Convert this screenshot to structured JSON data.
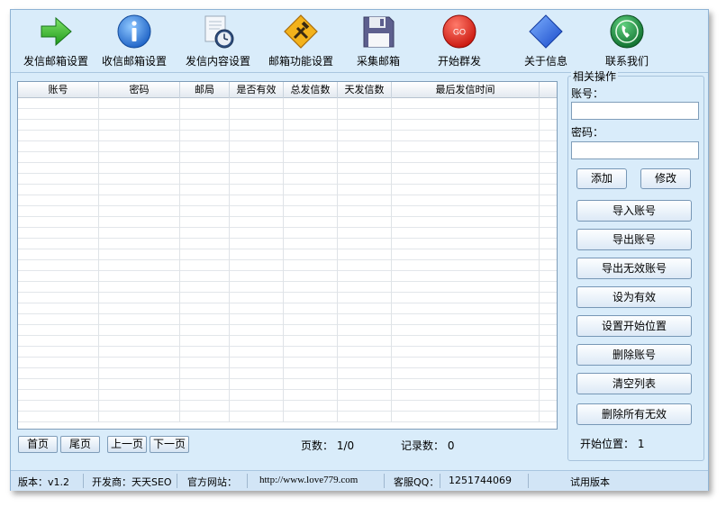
{
  "toolbar": {
    "items": [
      {
        "label": "发信邮箱设置",
        "icon": "green-arrow-icon"
      },
      {
        "label": "收信邮箱设置",
        "icon": "info-icon"
      },
      {
        "label": "发信内容设置",
        "icon": "document-clock-icon"
      },
      {
        "label": "邮箱功能设置",
        "icon": "tools-sign-icon"
      },
      {
        "label": "采集邮箱",
        "icon": "floppy-disk-icon"
      },
      {
        "label": "开始群发",
        "icon": "go-button-icon"
      },
      {
        "label": "关于信息",
        "icon": "blue-diamond-icon"
      },
      {
        "label": "联系我们",
        "icon": "phone-icon"
      }
    ]
  },
  "grid": {
    "columns": [
      "账号",
      "密码",
      "邮局",
      "是否有效",
      "总发信数",
      "天发信数",
      "最后发信时间",
      ""
    ],
    "rows": []
  },
  "pager": {
    "first": "首页",
    "last": "尾页",
    "prev": "上一页",
    "next": "下一页",
    "pages_text": "页数： 1/0",
    "records_text": "记录数： 0"
  },
  "panel": {
    "title": "相关操作",
    "account_label": "账号：",
    "account_value": "",
    "password_label": "密码：",
    "password_value": "",
    "add": "添加",
    "edit": "修改",
    "import": "导入账号",
    "export": "导出账号",
    "export_invalid": "导出无效账号",
    "set_valid": "设为有效",
    "set_start": "设置开始位置",
    "delete": "删除账号",
    "clear": "清空列表",
    "delete_invalid": "删除所有无效",
    "start_pos": "开始位置： 1"
  },
  "status": {
    "version": "版本：v1.2",
    "developer": "开发商：天天SEO",
    "site_label": "官方网站：",
    "site_url": "http://www.love779.com",
    "qq_label": "客服QQ：",
    "qq": "1251744069",
    "trial": "试用版本"
  },
  "colors": {
    "window_bg": "#d9ecfa",
    "border": "#7f9db9"
  }
}
